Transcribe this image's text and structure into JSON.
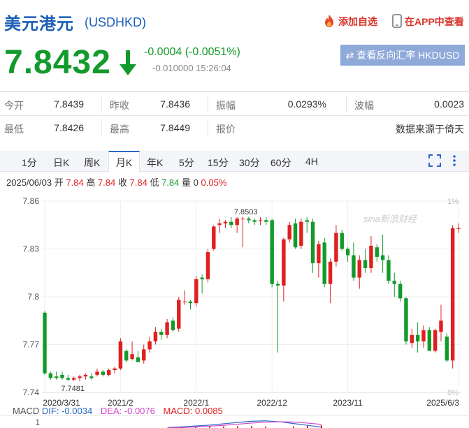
{
  "header": {
    "name": "美元港元",
    "code": "(USDHKD)",
    "favorite_label": "添加自选",
    "app_label": "在APP中查看"
  },
  "quote": {
    "price": "7.8432",
    "change": "-0.0004 (-0.0051%)",
    "sub_change": "-0.010000",
    "time": "15:26:04",
    "invert_button": "查看反向汇率 HKDUSD"
  },
  "stats": {
    "row1": [
      {
        "label": "今开",
        "value": "7.8439"
      },
      {
        "label": "昨收",
        "value": "7.8436"
      },
      {
        "label": "振幅",
        "value": "0.0293%"
      },
      {
        "label": "波幅",
        "value": "0.0023"
      }
    ],
    "row2": [
      {
        "label": "最低",
        "value": "7.8426"
      },
      {
        "label": "最高",
        "value": "7.8449"
      },
      {
        "label": "报价",
        "value": "数据来源于倚天"
      }
    ]
  },
  "tabs": [
    "1分",
    "日K",
    "周K",
    "月K",
    "年K",
    "5分",
    "15分",
    "30分",
    "60分",
    "4H"
  ],
  "active_tab": "月K",
  "ohlc": {
    "date": "2025/06/03",
    "open_label": "开",
    "open": "7.84",
    "high_label": "高",
    "high": "7.84",
    "close_label": "收",
    "close": "7.84",
    "low_label": "低",
    "low": "7.84",
    "vol_label": "量",
    "vol": "0",
    "pct": "0.05%"
  },
  "macd": {
    "title": "MACD",
    "dif_label": "DIF:",
    "dif": "-0.0034",
    "dea_label": "DEA:",
    "dea": "-0.0076",
    "macd_label": "MACD:",
    "macd": "0.0085",
    "axis_tick": "1"
  },
  "watermark": "sina新浪财经",
  "colors": {
    "up": "#e02020",
    "down": "#139a2c",
    "brand": "#1b5eb6",
    "dif": "#2a68c8",
    "dea": "#d047c9",
    "macd": "#e02020"
  },
  "chart_data": {
    "type": "candlestick",
    "ylim": [
      7.74,
      7.86
    ],
    "y_ticks": [
      "7.86",
      "7.83",
      "7.8",
      "7.77",
      "7.74"
    ],
    "y_tick_values": [
      7.86,
      7.83,
      7.8,
      7.77,
      7.74
    ],
    "right_ticks": [
      "1%",
      "0%"
    ],
    "x_ticks": [
      "2020/3/31",
      "2021/2",
      "2022/1",
      "2022/12",
      "2023/11",
      "2025/6/3"
    ],
    "max_label": "7.8503",
    "min_label": "7.7481",
    "candles": [
      {
        "o": 7.79,
        "h": 7.791,
        "l": 7.751,
        "c": 7.752
      },
      {
        "o": 7.752,
        "h": 7.753,
        "l": 7.748,
        "c": 7.749
      },
      {
        "o": 7.75,
        "h": 7.753,
        "l": 7.748,
        "c": 7.749
      },
      {
        "o": 7.751,
        "h": 7.753,
        "l": 7.748,
        "c": 7.749
      },
      {
        "o": 7.749,
        "h": 7.751,
        "l": 7.747,
        "c": 7.748
      },
      {
        "o": 7.748,
        "h": 7.75,
        "l": 7.747,
        "c": 7.749
      },
      {
        "o": 7.749,
        "h": 7.751,
        "l": 7.747,
        "c": 7.75
      },
      {
        "o": 7.75,
        "h": 7.752,
        "l": 7.748,
        "c": 7.751
      },
      {
        "o": 7.75,
        "h": 7.752,
        "l": 7.748,
        "c": 7.749
      },
      {
        "o": 7.751,
        "h": 7.755,
        "l": 7.75,
        "c": 7.753
      },
      {
        "o": 7.753,
        "h": 7.754,
        "l": 7.75,
        "c": 7.751
      },
      {
        "o": 7.751,
        "h": 7.755,
        "l": 7.75,
        "c": 7.754
      },
      {
        "o": 7.754,
        "h": 7.756,
        "l": 7.752,
        "c": 7.755
      },
      {
        "o": 7.755,
        "h": 7.774,
        "l": 7.754,
        "c": 7.772
      },
      {
        "o": 7.766,
        "h": 7.767,
        "l": 7.759,
        "c": 7.76
      },
      {
        "o": 7.761,
        "h": 7.772,
        "l": 7.76,
        "c": 7.764
      },
      {
        "o": 7.762,
        "h": 7.766,
        "l": 7.759,
        "c": 7.759
      },
      {
        "o": 7.76,
        "h": 7.77,
        "l": 7.758,
        "c": 7.767
      },
      {
        "o": 7.767,
        "h": 7.775,
        "l": 7.765,
        "c": 7.772
      },
      {
        "o": 7.772,
        "h": 7.781,
        "l": 7.77,
        "c": 7.778
      },
      {
        "o": 7.778,
        "h": 7.78,
        "l": 7.773,
        "c": 7.776
      },
      {
        "o": 7.776,
        "h": 7.786,
        "l": 7.774,
        "c": 7.784
      },
      {
        "o": 7.785,
        "h": 7.787,
        "l": 7.778,
        "c": 7.779
      },
      {
        "o": 7.78,
        "h": 7.8,
        "l": 7.778,
        "c": 7.798
      },
      {
        "o": 7.797,
        "h": 7.804,
        "l": 7.795,
        "c": 7.797
      },
      {
        "o": 7.797,
        "h": 7.798,
        "l": 7.792,
        "c": 7.796
      },
      {
        "o": 7.796,
        "h": 7.813,
        "l": 7.794,
        "c": 7.811
      },
      {
        "o": 7.812,
        "h": 7.814,
        "l": 7.802,
        "c": 7.811
      },
      {
        "o": 7.811,
        "h": 7.83,
        "l": 7.809,
        "c": 7.828
      },
      {
        "o": 7.83,
        "h": 7.845,
        "l": 7.829,
        "c": 7.844
      },
      {
        "o": 7.845,
        "h": 7.849,
        "l": 7.84,
        "c": 7.846
      },
      {
        "o": 7.846,
        "h": 7.848,
        "l": 7.843,
        "c": 7.847
      },
      {
        "o": 7.847,
        "h": 7.85,
        "l": 7.843,
        "c": 7.845
      },
      {
        "o": 7.845,
        "h": 7.85,
        "l": 7.84,
        "c": 7.849
      },
      {
        "o": 7.849,
        "h": 7.85,
        "l": 7.831,
        "c": 7.849
      },
      {
        "o": 7.849,
        "h": 7.85,
        "l": 7.846,
        "c": 7.848
      },
      {
        "o": 7.848,
        "h": 7.849,
        "l": 7.845,
        "c": 7.847
      },
      {
        "o": 7.848,
        "h": 7.85,
        "l": 7.845,
        "c": 7.848
      },
      {
        "o": 7.848,
        "h": 7.85,
        "l": 7.845,
        "c": 7.847
      },
      {
        "o": 7.848,
        "h": 7.849,
        "l": 7.806,
        "c": 7.808
      },
      {
        "o": 7.808,
        "h": 7.81,
        "l": 7.765,
        "c": 7.807
      },
      {
        "o": 7.807,
        "h": 7.837,
        "l": 7.797,
        "c": 7.836
      },
      {
        "o": 7.836,
        "h": 7.847,
        "l": 7.834,
        "c": 7.845
      },
      {
        "o": 7.846,
        "h": 7.849,
        "l": 7.83,
        "c": 7.831
      },
      {
        "o": 7.832,
        "h": 7.849,
        "l": 7.83,
        "c": 7.847
      },
      {
        "o": 7.848,
        "h": 7.85,
        "l": 7.84,
        "c": 7.847
      },
      {
        "o": 7.847,
        "h": 7.849,
        "l": 7.815,
        "c": 7.821
      },
      {
        "o": 7.821,
        "h": 7.835,
        "l": 7.812,
        "c": 7.833
      },
      {
        "o": 7.834,
        "h": 7.837,
        "l": 7.806,
        "c": 7.808
      },
      {
        "o": 7.808,
        "h": 7.824,
        "l": 7.796,
        "c": 7.822
      },
      {
        "o": 7.822,
        "h": 7.845,
        "l": 7.819,
        "c": 7.84
      },
      {
        "o": 7.84,
        "h": 7.842,
        "l": 7.829,
        "c": 7.83
      },
      {
        "o": 7.83,
        "h": 7.831,
        "l": 7.822,
        "c": 7.826
      },
      {
        "o": 7.826,
        "h": 7.834,
        "l": 7.81,
        "c": 7.812
      },
      {
        "o": 7.812,
        "h": 7.826,
        "l": 7.805,
        "c": 7.823
      },
      {
        "o": 7.823,
        "h": 7.83,
        "l": 7.815,
        "c": 7.818
      },
      {
        "o": 7.818,
        "h": 7.838,
        "l": 7.815,
        "c": 7.832
      },
      {
        "o": 7.831,
        "h": 7.833,
        "l": 7.822,
        "c": 7.825
      },
      {
        "o": 7.826,
        "h": 7.839,
        "l": 7.815,
        "c": 7.823
      },
      {
        "o": 7.823,
        "h": 7.826,
        "l": 7.808,
        "c": 7.81
      },
      {
        "o": 7.81,
        "h": 7.815,
        "l": 7.8,
        "c": 7.808
      },
      {
        "o": 7.808,
        "h": 7.81,
        "l": 7.797,
        "c": 7.799
      },
      {
        "o": 7.799,
        "h": 7.8,
        "l": 7.77,
        "c": 7.772
      },
      {
        "o": 7.771,
        "h": 7.78,
        "l": 7.768,
        "c": 7.776
      },
      {
        "o": 7.776,
        "h": 7.784,
        "l": 7.765,
        "c": 7.772
      },
      {
        "o": 7.772,
        "h": 7.782,
        "l": 7.768,
        "c": 7.779
      },
      {
        "o": 7.779,
        "h": 7.781,
        "l": 7.766,
        "c": 7.766
      },
      {
        "o": 7.766,
        "h": 7.78,
        "l": 7.765,
        "c": 7.779
      },
      {
        "o": 7.778,
        "h": 7.795,
        "l": 7.772,
        "c": 7.785
      },
      {
        "o": 7.775,
        "h": 7.777,
        "l": 7.759,
        "c": 7.76
      },
      {
        "o": 7.76,
        "h": 7.845,
        "l": 7.755,
        "c": 7.843
      },
      {
        "o": 7.843,
        "h": 7.846,
        "l": 7.84,
        "c": 7.843
      }
    ],
    "macd_series": {
      "dif": [
        0.2,
        0.5,
        0.9,
        1.3,
        1.9,
        2.5,
        3.0,
        3.2,
        2.8,
        2.0,
        1.2,
        0.4
      ],
      "dea": [
        0.1,
        0.2,
        0.5,
        0.8,
        1.2,
        1.7,
        2.2,
        2.6,
        2.8,
        2.7,
        2.2,
        1.6
      ]
    }
  }
}
